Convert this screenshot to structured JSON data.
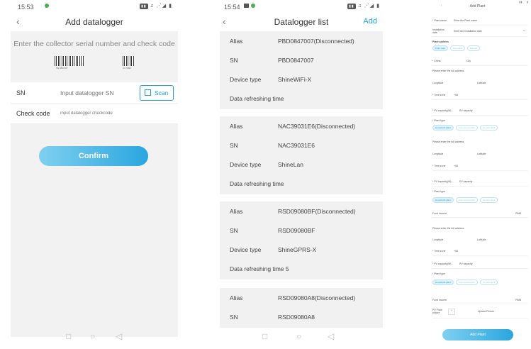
{
  "phone1": {
    "time": "15:53",
    "title": "Add datalogger",
    "hint": "Enter the collector serial number and check code",
    "barcode1_label": "SN 0847007",
    "barcode2_label": "CC 5890",
    "sn_label": "SN",
    "sn_placeholder": "Input datalogger SN",
    "scan_label": "Scan",
    "check_label": "Check code",
    "check_placeholder": "Input datalogger checkcode",
    "confirm_label": "Confirm"
  },
  "phone2": {
    "time": "15:54",
    "title": "Datalogger list",
    "add_label": "Add",
    "cards": [
      {
        "alias_k": "Alias",
        "alias": "PBD0847007(Disconnected)",
        "sn_k": "SN",
        "sn": "PBD0847007",
        "dev_k": "Device type",
        "dev": "ShineWiFi-X",
        "refresh": "Data refreshing time"
      },
      {
        "alias_k": "Alias",
        "alias": "NAC39031E6(Disconnected)",
        "sn_k": "SN",
        "sn": "NAC39031E6",
        "dev_k": "Device type",
        "dev": "ShineLan",
        "refresh": "Data refreshing time"
      },
      {
        "alias_k": "Alias",
        "alias": "RSD09080BF(Disconnected)",
        "sn_k": "SN",
        "sn": "RSD09080BF",
        "dev_k": "Device type",
        "dev": "ShineGPRS-X",
        "refresh": "Data refreshing time 5"
      },
      {
        "alias_k": "Alias",
        "alias": "RSD09080A8(Disconnected)",
        "sn_k": "SN",
        "sn": "RSD09080A8"
      }
    ]
  },
  "phone3": {
    "title": "Add Plant",
    "plant_name": "* Plant name",
    "plant_name_ph": "Enter the Plant name",
    "install_date": "Installation date",
    "install_date_ph": "Enter the Installation date",
    "plant_address": "Plant address",
    "pills_addr": [
      "From map",
      "Automatic",
      "Manual"
    ],
    "china": "* China",
    "city": "City",
    "full_addr_ph": "Please enter the full address",
    "longitude": "Longitude",
    "latitude": "Latitude",
    "time_zone": "* Time zone",
    "tz_val": "+08",
    "pv_capacity": "* PV capacity(W)",
    "pv_capacity_ph": "PV capacity",
    "plant_type": "* Plant type",
    "pills_type": [
      "Household plant",
      "Commercial plant",
      "Ground plant"
    ],
    "fund_income": "Fund income",
    "fund_unit": "RMB",
    "pv_picture": "PV Plant picture",
    "upload_ph": "Upload Picture",
    "add_plant": "Add Plant"
  }
}
